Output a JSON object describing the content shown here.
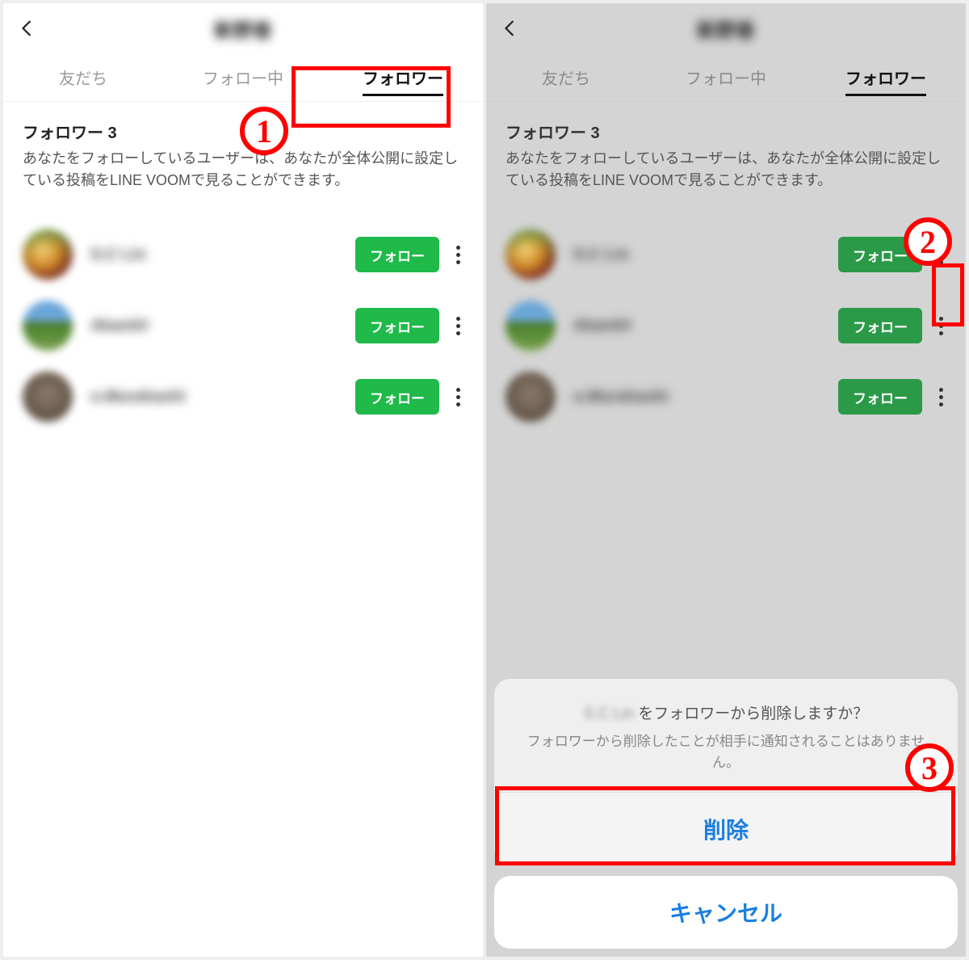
{
  "annotations": {
    "callouts": [
      "1",
      "2",
      "3"
    ]
  },
  "left": {
    "header_title": "新野香",
    "tabs": {
      "friends": "友だち",
      "following": "フォロー中",
      "followers": "フォロワー"
    },
    "section": {
      "title": "フォロワー 3",
      "desc": "あなたをフォローしているユーザーは、あなたが全体公開に設定している投稿をLINE VOOMで見ることができます。"
    },
    "rows": [
      {
        "name": "S.C Lin",
        "button": "フォロー"
      },
      {
        "name": "Akanti#",
        "button": "フォロー"
      },
      {
        "name": "o.Murahashi",
        "button": "フォロー"
      }
    ]
  },
  "right": {
    "header_title": "新野香",
    "tabs": {
      "friends": "友だち",
      "following": "フォロー中",
      "followers": "フォロワー"
    },
    "section": {
      "title": "フォロワー 3",
      "desc": "あなたをフォローしているユーザーは、あなたが全体公開に設定している投稿をLINE VOOMで見ることができます。"
    },
    "rows": [
      {
        "name": "S.C Lin",
        "button": "フォロー"
      },
      {
        "name": "Akanti#",
        "button": "フォロー"
      },
      {
        "name": "o.Murahashi",
        "button": "フォロー"
      }
    ],
    "sheet": {
      "head_name": "S.C Lin",
      "head_suffix": "をフォロワーから削除しますか？",
      "head_sub": "フォロワーから削除したことが相手に通知されることはありません。",
      "delete": "削除",
      "cancel": "キャンセル"
    }
  }
}
